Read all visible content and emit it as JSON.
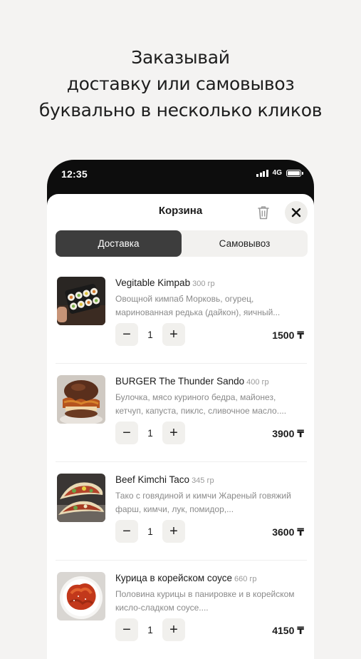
{
  "headline": {
    "line1": "Заказывай",
    "line2": "доставку или самовывоз",
    "line3": "буквально в несколько кликов"
  },
  "status_bar": {
    "time": "12:35",
    "network": "4G"
  },
  "cart": {
    "title": "Корзина",
    "tabs": [
      {
        "label": "Доставка",
        "active": true
      },
      {
        "label": "Самовывоз",
        "active": false
      }
    ],
    "items": [
      {
        "name": "Vegitable Kimpab",
        "weight": "300 гр",
        "description": "Овощной кимпаб Морковь, огурец, маринованная редька (дайкон), яичный...",
        "quantity": "1",
        "price": "1500 ₸"
      },
      {
        "name": "BURGER The Thunder Sando",
        "weight": "400 гр",
        "description": "Булочка, мясо куриного бедра, майонез, кетчуп, капуста, пиклс, сливочное масло....",
        "quantity": "1",
        "price": "3900 ₸"
      },
      {
        "name": "Beef Kimchi Taco",
        "weight": "345 гр",
        "description": "Тако с говядиной и кимчи Жареный говяжий фарш, кимчи, лук, помидор,...",
        "quantity": "1",
        "price": "3600 ₸"
      },
      {
        "name": "Курица в корейском соусе",
        "weight": "660 гр",
        "description": "Половина курицы в панировке и в корейском кисло-сладком соусе....",
        "quantity": "1",
        "price": "4150 ₸"
      }
    ],
    "stepper": {
      "minus": "−",
      "plus": "+"
    }
  },
  "colors": {
    "background": "#f4f3f2",
    "active_tab": "#3d3d3d",
    "button_bg": "#f1f0ed"
  }
}
